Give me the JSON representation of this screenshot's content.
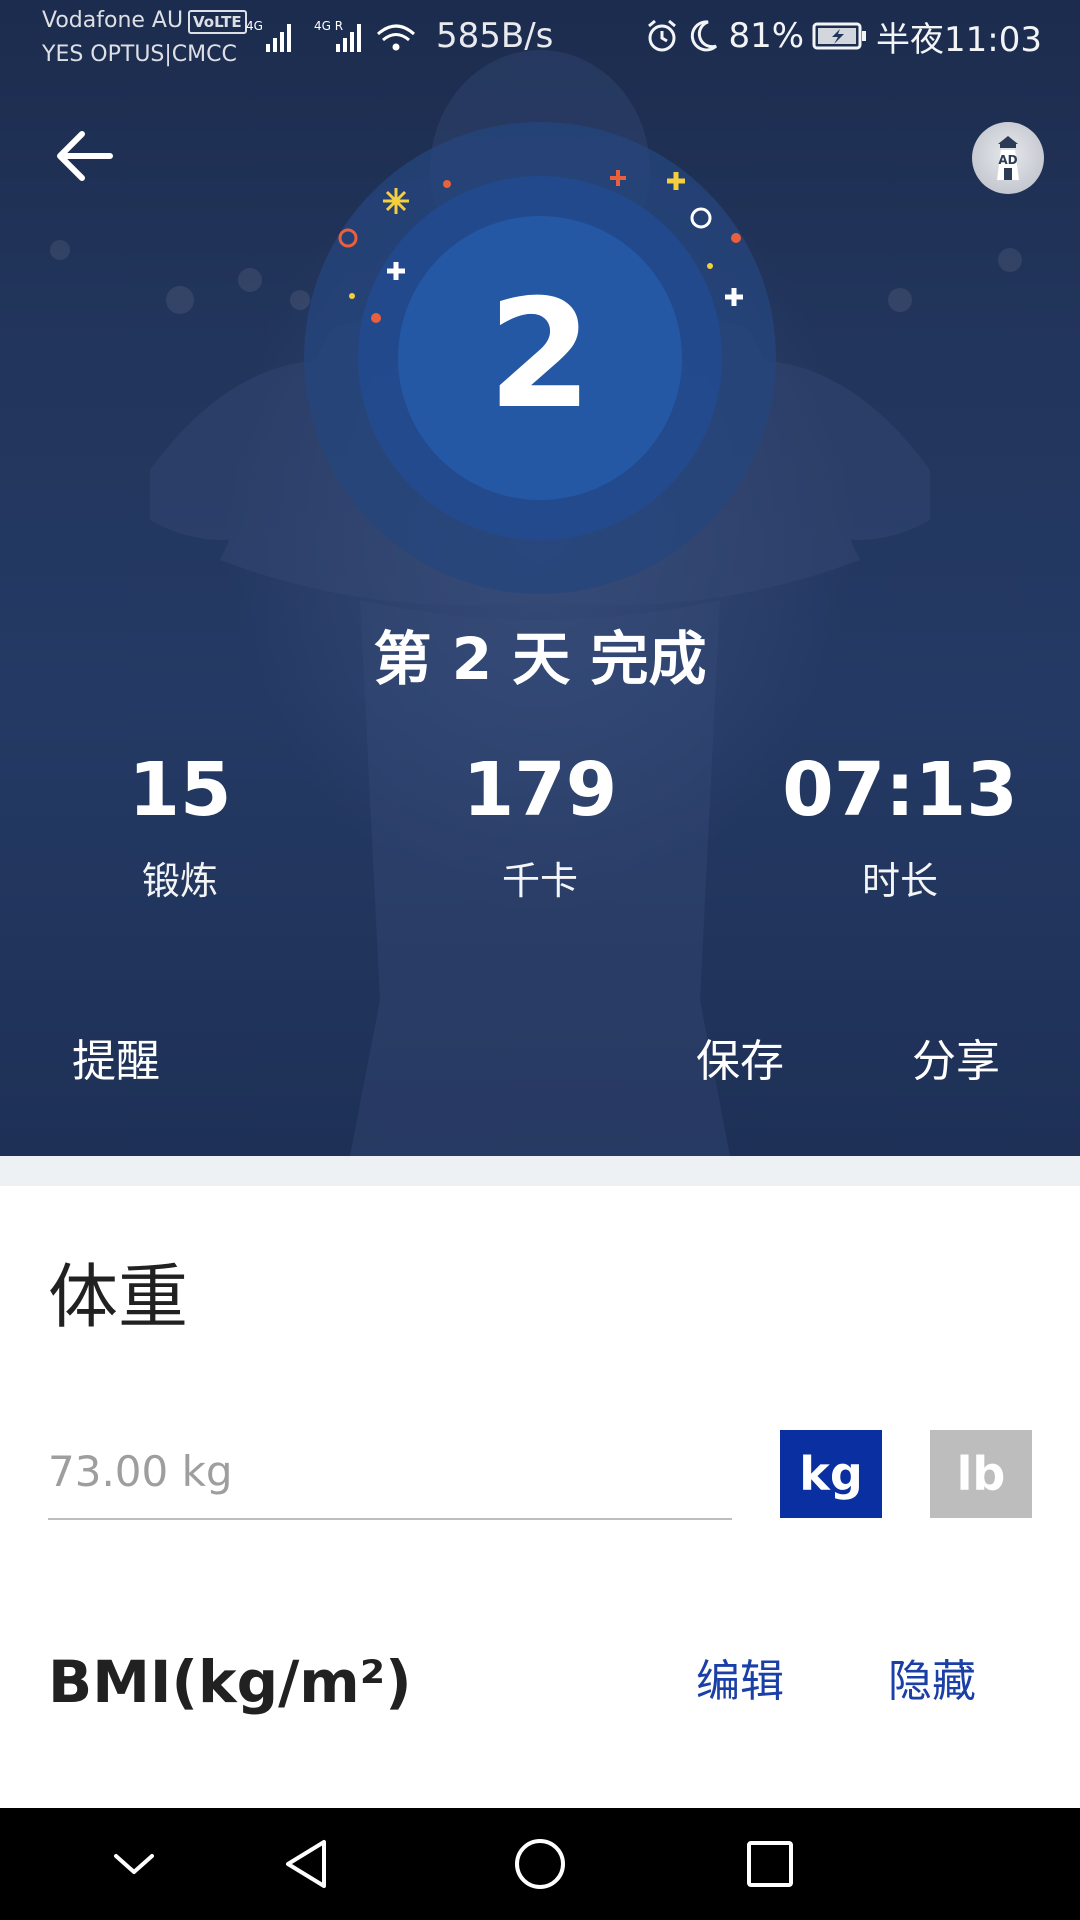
{
  "status_bar": {
    "carrier_line_1": "Vodafone AU",
    "volte_badge": "VoLTE",
    "carrier_line_2": "YES OPTUS|CMCC",
    "net_speed": "585B/s",
    "battery_percent": "81%",
    "time": "半夜11:03"
  },
  "hero": {
    "ad_label": "AD",
    "day_number": "2",
    "day_complete": "第 2 天 完成",
    "stats": [
      {
        "value": "15",
        "label": "锻炼"
      },
      {
        "value": "179",
        "label": "千卡"
      },
      {
        "value": "07:13",
        "label": "时长"
      }
    ],
    "actions": {
      "remind": "提醒",
      "save": "保存",
      "share": "分享"
    }
  },
  "weight": {
    "title": "体重",
    "placeholder": "73.00 kg",
    "units": {
      "kg": "kg",
      "lb": "lb"
    },
    "selected_unit": "kg"
  },
  "bmi": {
    "title": "BMI(kg/m²)",
    "edit": "编辑",
    "hide": "隐藏"
  },
  "colors": {
    "hero_background": "#22355c",
    "accent_blue": "#0a2fa0",
    "link_blue": "#1a3fa6",
    "unit_inactive": "#bdbdbd"
  }
}
